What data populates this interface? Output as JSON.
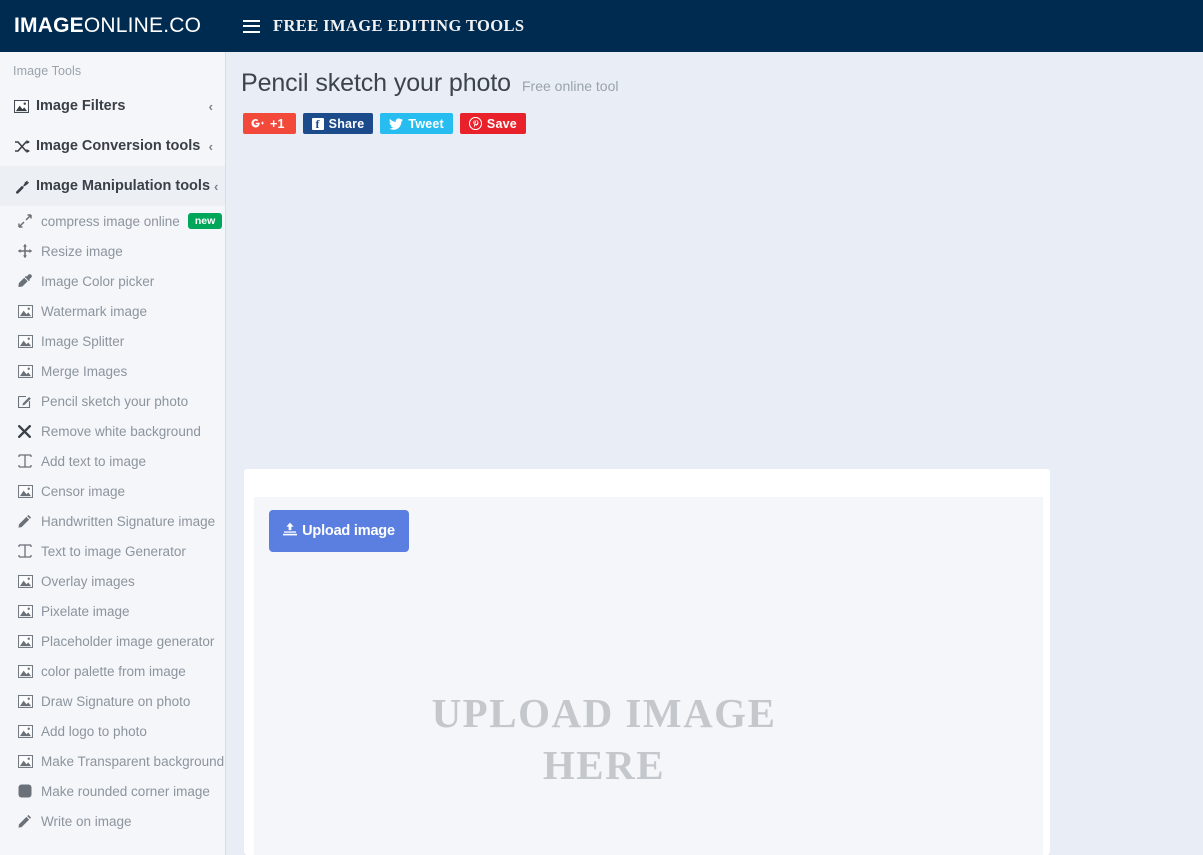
{
  "navbar": {
    "brand_bold": "IMAGE",
    "brand_light": " ONLINE.CO",
    "menu_icon": "hamburger-icon",
    "title": "FREE IMAGE EDITING TOOLS",
    "background_color": "#002b50"
  },
  "sidebar": {
    "header": "Image Tools",
    "groups": [
      {
        "label": "Image Filters",
        "icon": "picture-icon",
        "chevron": "‹",
        "active": false
      },
      {
        "label": "Image Conversion tools",
        "icon": "shuffle-icon",
        "chevron": "‹",
        "active": false
      },
      {
        "label": "Image Manipulation tools",
        "icon": "wrench-icon",
        "chevron": "‹",
        "active": true
      }
    ],
    "items": [
      {
        "label": "compress image online",
        "icon": "compress-icon",
        "badge": "new"
      },
      {
        "label": "Resize image",
        "icon": "arrows-move-icon",
        "badge": ""
      },
      {
        "label": "Image Color picker",
        "icon": "eyedropper-icon",
        "badge": ""
      },
      {
        "label": "Watermark image",
        "icon": "picture-icon",
        "badge": ""
      },
      {
        "label": "Image Splitter",
        "icon": "picture-icon",
        "badge": ""
      },
      {
        "label": "Merge Images",
        "icon": "picture-icon",
        "badge": ""
      },
      {
        "label": "Pencil sketch your photo",
        "icon": "pencil-square-icon",
        "badge": ""
      },
      {
        "label": "Remove white background",
        "icon": "close-x-icon",
        "badge": ""
      },
      {
        "label": "Add text to image",
        "icon": "text-height-icon",
        "badge": ""
      },
      {
        "label": "Censor image",
        "icon": "picture-icon",
        "badge": ""
      },
      {
        "label": "Handwritten Signature image",
        "icon": "pencil-icon",
        "badge": ""
      },
      {
        "label": "Text to image Generator",
        "icon": "text-height-icon",
        "badge": ""
      },
      {
        "label": "Overlay images",
        "icon": "picture-icon",
        "badge": ""
      },
      {
        "label": "Pixelate image",
        "icon": "picture-icon",
        "badge": ""
      },
      {
        "label": "Placeholder image generator",
        "icon": "picture-icon",
        "badge": ""
      },
      {
        "label": "color palette from image",
        "icon": "picture-icon",
        "badge": ""
      },
      {
        "label": "Draw Signature on photo",
        "icon": "picture-icon",
        "badge": ""
      },
      {
        "label": "Add logo to photo",
        "icon": "picture-icon",
        "badge": ""
      },
      {
        "label": "Make Transparent background",
        "icon": "picture-icon",
        "badge": ""
      },
      {
        "label": "Make rounded corner image",
        "icon": "rounded-square-icon",
        "badge": ""
      },
      {
        "label": "Write on image",
        "icon": "pencil-icon",
        "badge": ""
      }
    ],
    "badge_color": "#00a65a"
  },
  "main": {
    "title": "Pencil sketch your photo",
    "subtitle": "Free online tool",
    "share_buttons": [
      {
        "label": "+1",
        "icon": "google-plus-icon",
        "color": "#f2493a"
      },
      {
        "label": "Share",
        "icon": "facebook-icon",
        "color": "#1c4b8c"
      },
      {
        "label": "Tweet",
        "icon": "twitter-icon",
        "color": "#28bdf0"
      },
      {
        "label": "Save",
        "icon": "pinterest-icon",
        "color": "#e8212b"
      }
    ],
    "upload": {
      "button_label": "Upload image",
      "button_icon": "upload-icon",
      "button_color": "#5b7fe0",
      "placeholder_line1": "UPLOAD IMAGE",
      "placeholder_line2": "HERE"
    }
  }
}
